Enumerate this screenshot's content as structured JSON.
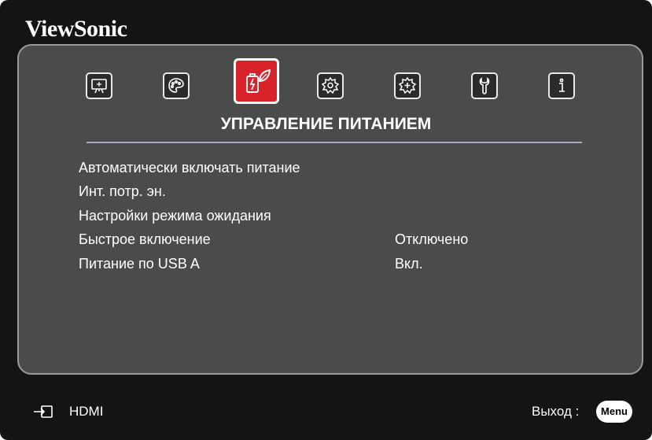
{
  "brand": "ViewSonic",
  "tabs": [
    {
      "icon": "display-icon",
      "active": false
    },
    {
      "icon": "palette-icon",
      "active": false
    },
    {
      "icon": "power-management-icon",
      "active": true
    },
    {
      "icon": "gear-icon",
      "active": false
    },
    {
      "icon": "advanced-gear-icon",
      "active": false
    },
    {
      "icon": "wrench-icon",
      "active": false
    },
    {
      "icon": "info-icon",
      "active": false
    }
  ],
  "section_title": "УПРАВЛЕНИЕ ПИТАНИЕМ",
  "menu_items": [
    {
      "label": "Автоматически включать питание",
      "value": ""
    },
    {
      "label": "Инт. потр. эн.",
      "value": ""
    },
    {
      "label": "Настройки режима ожидания",
      "value": ""
    },
    {
      "label": "Быстрое включение",
      "value": "Отключено"
    },
    {
      "label": "Питание по USB A",
      "value": "Вкл."
    }
  ],
  "footer": {
    "source_icon": "input-source-icon",
    "source_label": "HDMI",
    "exit_label": "Выход :",
    "menu_key_label": "Menu"
  },
  "colors": {
    "accent": "#d8232a",
    "panel": "#4a4b4b",
    "frame": "#141414",
    "divider": "#a7a7c8"
  }
}
